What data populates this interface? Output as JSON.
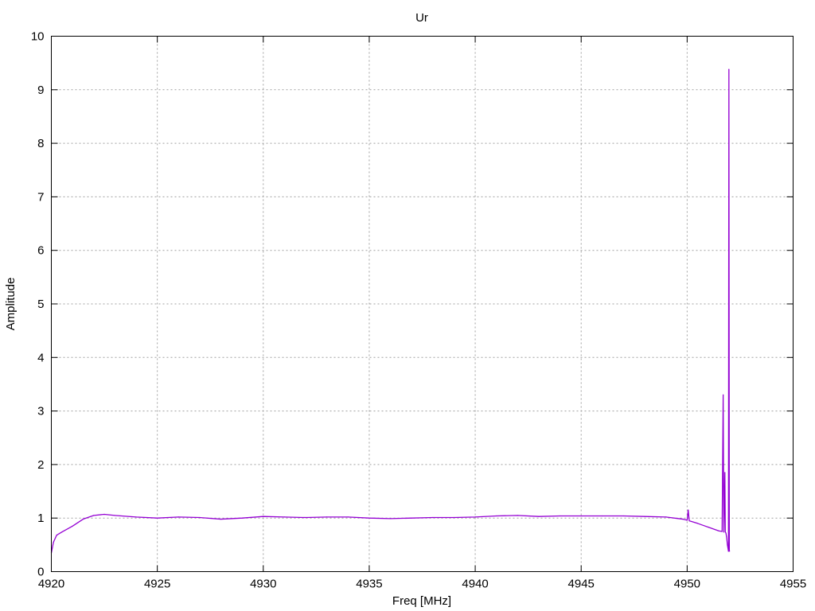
{
  "chart_data": {
    "type": "line",
    "title": "Ur",
    "xlabel": "Freq [MHz]",
    "ylabel": "Amplitude",
    "xlim": [
      4920,
      4955
    ],
    "ylim": [
      0,
      10
    ],
    "xticks": [
      4920,
      4925,
      4930,
      4935,
      4940,
      4945,
      4950,
      4955
    ],
    "yticks": [
      0,
      1,
      2,
      3,
      4,
      5,
      6,
      7,
      8,
      9,
      10
    ],
    "grid": true,
    "legend": "none",
    "series": [
      {
        "color": "#9400d3",
        "x": [
          4920.0,
          4920.1,
          4920.25,
          4920.5,
          4921.0,
          4921.5,
          4922.0,
          4922.5,
          4923.0,
          4924.0,
          4925.0,
          4926.0,
          4927.0,
          4928.0,
          4929.0,
          4930.0,
          4931.0,
          4932.0,
          4933.0,
          4934.0,
          4935.0,
          4936.0,
          4937.0,
          4938.0,
          4939.0,
          4940.0,
          4941.0,
          4942.0,
          4943.0,
          4944.0,
          4945.0,
          4946.0,
          4947.0,
          4948.0,
          4949.0,
          4949.8,
          4950.0,
          4950.05,
          4950.1,
          4950.5,
          4951.0,
          4951.5,
          4951.65,
          4951.7,
          4951.73,
          4951.78,
          4951.8,
          4951.83,
          4951.86,
          4951.9,
          4951.95,
          4951.97,
          4951.99,
          4952.0
        ],
        "y": [
          0.35,
          0.55,
          0.68,
          0.74,
          0.85,
          0.98,
          1.05,
          1.07,
          1.05,
          1.02,
          1.0,
          1.02,
          1.01,
          0.98,
          1.0,
          1.03,
          1.02,
          1.01,
          1.02,
          1.02,
          1.0,
          0.99,
          1.0,
          1.01,
          1.01,
          1.02,
          1.04,
          1.05,
          1.03,
          1.04,
          1.04,
          1.04,
          1.04,
          1.03,
          1.02,
          0.98,
          0.96,
          1.15,
          0.95,
          0.9,
          0.83,
          0.76,
          0.75,
          3.3,
          0.74,
          1.85,
          0.74,
          0.72,
          0.65,
          0.5,
          0.38,
          9.38,
          0.4,
          0.38
        ]
      }
    ]
  }
}
